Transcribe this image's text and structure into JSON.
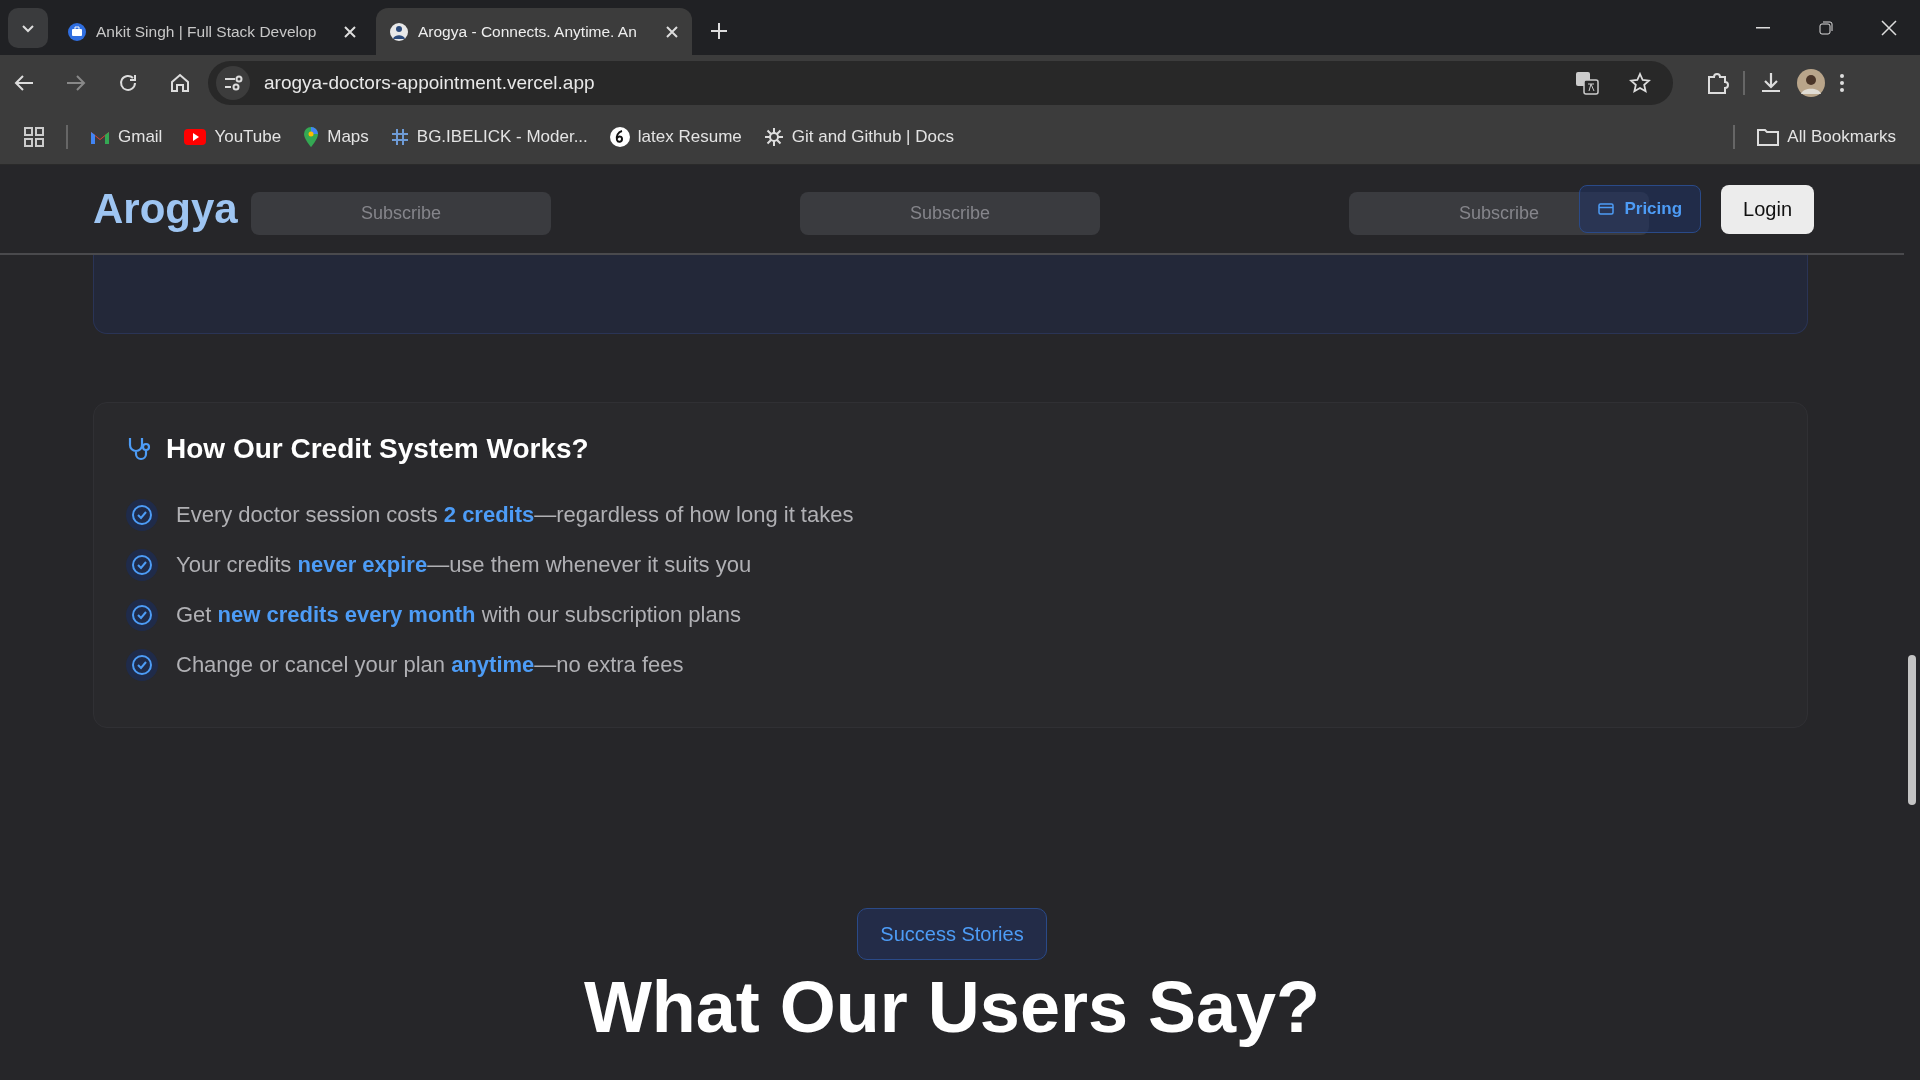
{
  "browser": {
    "tabs": [
      {
        "title": "Ankit Singh | Full Stack Develop",
        "selected": false
      },
      {
        "title": "Arogya - Connects. Anytime. An",
        "selected": true
      }
    ],
    "url": "arogya-doctors-appointment.vercel.app",
    "bookmarks": [
      {
        "label": "Gmail"
      },
      {
        "label": "YouTube"
      },
      {
        "label": "Maps"
      },
      {
        "label": "BG.IBELICK - Moder..."
      },
      {
        "label": "latex Resume"
      },
      {
        "label": "Git and Github | Docs"
      }
    ],
    "all_bookmarks": "All Bookmarks"
  },
  "header": {
    "logo": "Arogya",
    "behind_buttons": [
      "Subscribe",
      "Subscribe",
      "Subscribe"
    ],
    "pricing": "Pricing",
    "login": "Login"
  },
  "credit_section": {
    "title": "How Our Credit System Works?",
    "items": [
      "Every doctor session costs **2 credits**—regardless of how long it takes",
      "Your credits **never expire**—use them whenever it suits you",
      "Get **new credits every month** with our subscription plans",
      "Change or cancel your plan **anytime**—no extra fees"
    ]
  },
  "testimonials": {
    "badge": "Success Stories",
    "title": "What Our Users Say?"
  }
}
